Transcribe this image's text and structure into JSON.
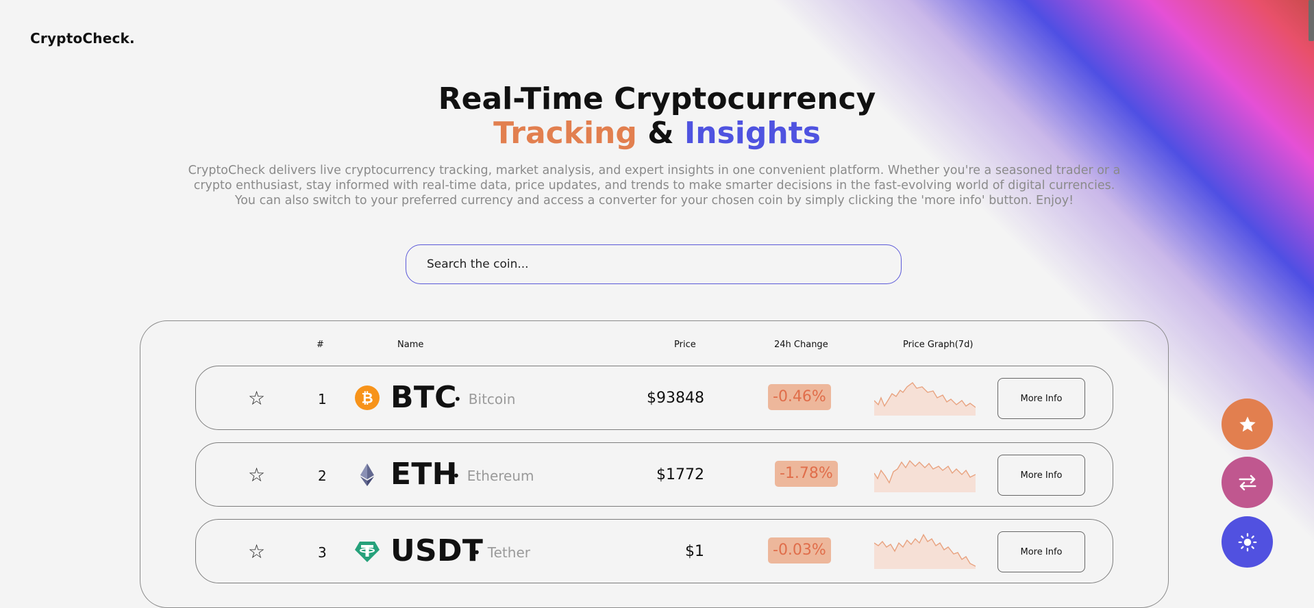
{
  "brand": "CryptoCheck.",
  "hero": {
    "title_line1": "Real-Time Cryptocurrency",
    "title_word1": "Tracking",
    "title_amp": "&",
    "title_word2": "Insights",
    "description": "CryptoCheck delivers live cryptocurrency tracking, market analysis, and expert insights in one convenient platform. Whether you're a seasoned trader or a crypto enthusiast, stay informed with real-time data, price updates, and trends to make smarter decisions in the fast-evolving world of digital currencies. You can also switch to your preferred currency and access a converter for your chosen coin by simply clicking the 'more info' button. Enjoy!"
  },
  "search": {
    "placeholder": "Search the coin..."
  },
  "table": {
    "headers": {
      "rank": "#",
      "name": "Name",
      "price": "Price",
      "change": "24h Change",
      "graph": "Price Graph(7d)"
    },
    "rows": [
      {
        "rank": "1",
        "symbol": "BTC",
        "sep": "•",
        "name": "Bitcoin",
        "price": "$93848",
        "change": "-0.46%",
        "icon": "bitcoin-icon",
        "icon_color": "#f7931a",
        "more": "More Info"
      },
      {
        "rank": "2",
        "symbol": "ETH",
        "sep": "•",
        "name": "Ethereum",
        "price": "$1772",
        "change": "-1.78%",
        "icon": "ethereum-icon",
        "icon_color": "#62688f",
        "more": "More Info"
      },
      {
        "rank": "3",
        "symbol": "USDT",
        "sep": "•",
        "name": "Tether",
        "price": "$1",
        "change": "-0.03%",
        "icon": "tether-icon",
        "icon_color": "#26a17b",
        "more": "More Info"
      }
    ]
  },
  "fabs": [
    {
      "icon": "star-icon",
      "color": "#e27f4f"
    },
    {
      "icon": "swap-arrows-icon",
      "color": "#c0578f"
    },
    {
      "icon": "sun-icon",
      "color": "#5151e0"
    }
  ],
  "colors": {
    "accent_orange": "#e27f4f",
    "accent_blue": "#4f53e0",
    "negative_change_bg": "#edb79b",
    "negative_change_text": "#e06d4a"
  }
}
